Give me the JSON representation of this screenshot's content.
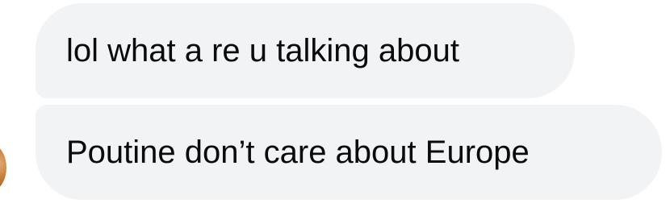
{
  "messages": [
    {
      "text": "lol what a re u talking about"
    },
    {
      "text": "Poutine don’t care about Europe"
    }
  ],
  "colors": {
    "bubble_background": "#f2f3f5",
    "text": "#0b0b0b",
    "page_background": "#ffffff"
  }
}
